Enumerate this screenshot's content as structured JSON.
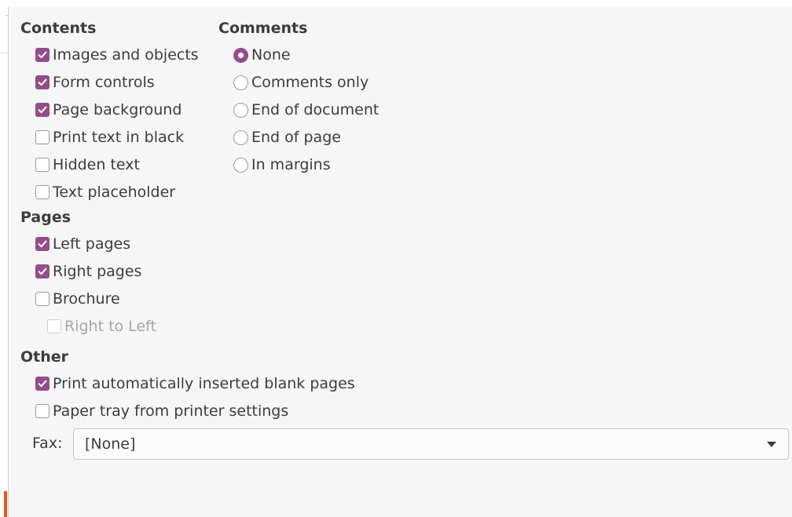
{
  "contents": {
    "heading": "Contents",
    "items": [
      {
        "label": "Images and objects",
        "checked": true
      },
      {
        "label": "Form controls",
        "checked": true
      },
      {
        "label": "Page background",
        "checked": true
      },
      {
        "label": "Print text in black",
        "checked": false
      },
      {
        "label": "Hidden text",
        "checked": false
      },
      {
        "label": "Text placeholder",
        "checked": false
      }
    ]
  },
  "comments": {
    "heading": "Comments",
    "options": [
      {
        "label": "None",
        "selected": true
      },
      {
        "label": "Comments only",
        "selected": false
      },
      {
        "label": "End of document",
        "selected": false
      },
      {
        "label": "End of page",
        "selected": false
      },
      {
        "label": "In margins",
        "selected": false
      }
    ]
  },
  "pages": {
    "heading": "Pages",
    "items": [
      {
        "label": "Left pages",
        "checked": true
      },
      {
        "label": "Right pages",
        "checked": true
      },
      {
        "label": "Brochure",
        "checked": false
      },
      {
        "label": "Right to Left",
        "checked": false,
        "disabled": true
      }
    ]
  },
  "other": {
    "heading": "Other",
    "items": [
      {
        "label": "Print automatically inserted blank pages",
        "checked": true
      },
      {
        "label": "Paper tray from printer settings",
        "checked": false
      }
    ],
    "fax_label": "Fax:",
    "fax_value": "[None]"
  },
  "colors": {
    "accent": "#924d8b",
    "text": "#3c3c3c",
    "disabled": "#a6a6a6",
    "panel": "#f6f6f6"
  }
}
